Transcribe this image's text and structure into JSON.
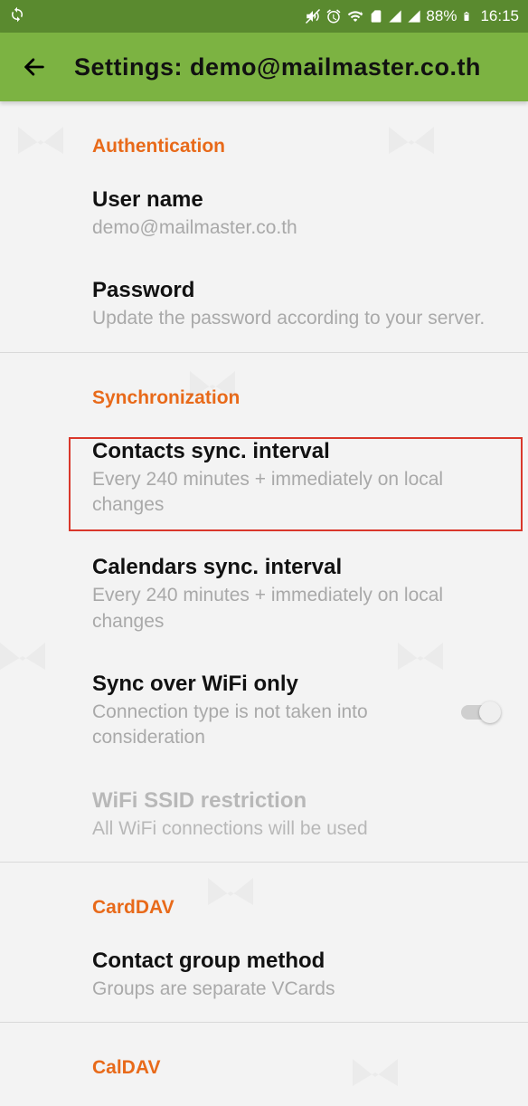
{
  "statusbar": {
    "battery_pct": "88%",
    "time": "16:15"
  },
  "appbar": {
    "title": "Settings: demo@mailmaster.co.th"
  },
  "sections": {
    "authentication": {
      "header": "Authentication",
      "username": {
        "title": "User name",
        "value": "demo@mailmaster.co.th"
      },
      "password": {
        "title": "Password",
        "desc": "Update the password according to your server."
      }
    },
    "synchronization": {
      "header": "Synchronization",
      "contacts_interval": {
        "title": "Contacts sync. interval",
        "desc": "Every 240 minutes + immediately on local changes"
      },
      "calendars_interval": {
        "title": "Calendars sync. interval",
        "desc": "Every 240 minutes + immediately on local changes"
      },
      "wifi_only": {
        "title": "Sync over WiFi only",
        "desc": "Connection type is not taken into consideration",
        "checked": false
      },
      "wifi_ssid": {
        "title": "WiFi SSID restriction",
        "desc": "All WiFi connections will be used",
        "enabled": false
      }
    },
    "carddav": {
      "header": "CardDAV",
      "group_method": {
        "title": "Contact group method",
        "desc": "Groups are separate VCards"
      }
    },
    "caldav": {
      "header": "CalDAV"
    }
  },
  "highlight_item": "contacts_interval"
}
